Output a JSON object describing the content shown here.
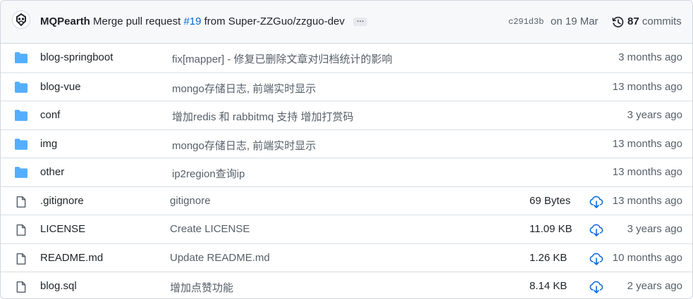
{
  "commit": {
    "author": "MQPearth",
    "message_before": "Merge pull request",
    "pr_number": "#19",
    "message_after": "from Super-ZZGuo/zzguo-dev",
    "ellipsis": "…",
    "sha": "c291d3b",
    "date": "on 19 Mar",
    "commits_count": "87",
    "commits_label": "commits"
  },
  "files": [
    {
      "type": "folder",
      "name": "blog-springboot",
      "message": "fix[mapper] - 修复已删除文章对归档统计的影响",
      "size": "",
      "age": "3 months ago"
    },
    {
      "type": "folder",
      "name": "blog-vue",
      "message": "mongo存储日志, 前端实时显示",
      "size": "",
      "age": "13 months ago"
    },
    {
      "type": "folder",
      "name": "conf",
      "message": "增加redis 和 rabbitmq 支持 增加打赏码",
      "size": "",
      "age": "3 years ago"
    },
    {
      "type": "folder",
      "name": "img",
      "message": "mongo存储日志, 前端实时显示",
      "size": "",
      "age": "13 months ago"
    },
    {
      "type": "folder",
      "name": "other",
      "message": "ip2region查询ip",
      "size": "",
      "age": "13 months ago"
    },
    {
      "type": "file",
      "name": ".gitignore",
      "message": "gitignore",
      "size": "69 Bytes",
      "age": "13 months ago"
    },
    {
      "type": "file",
      "name": "LICENSE",
      "message": "Create LICENSE",
      "size": "11.09 KB",
      "age": "3 years ago"
    },
    {
      "type": "file",
      "name": "README.md",
      "message": "Update README.md",
      "size": "1.26 KB",
      "age": "10 months ago"
    },
    {
      "type": "file",
      "name": "blog.sql",
      "message": "增加点赞功能",
      "size": "8.14 KB",
      "age": "2 years ago"
    }
  ],
  "icons": {
    "folder": "folder-icon",
    "file": "file-icon",
    "download": "download-cloud-icon",
    "history": "history-icon"
  },
  "colors": {
    "folder": "#54aeff",
    "link": "#0969da",
    "download": "#0969da"
  }
}
